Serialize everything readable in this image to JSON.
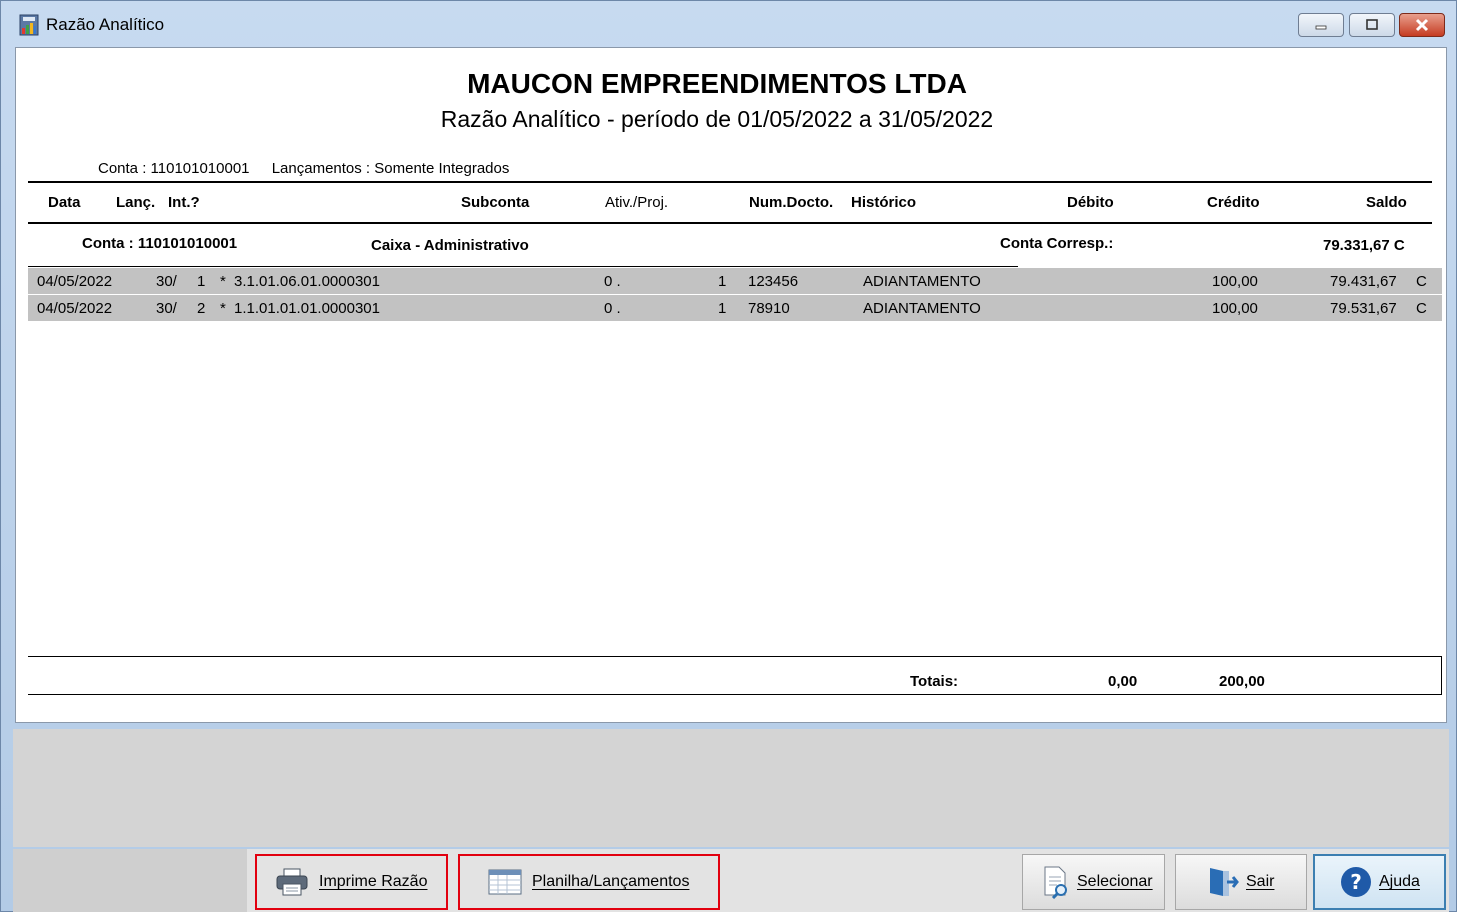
{
  "window": {
    "title": "Razão Analítico",
    "controls": [
      "minimize",
      "maximize",
      "close"
    ]
  },
  "report": {
    "company": "MAUCON EMPREENDIMENTOS LTDA",
    "subtitle": "Razão Analítico - período de 01/05/2022 a 31/05/2022",
    "conta_info": "Conta : 110101010001",
    "lancamentos_info": "Lançamentos : Somente Integrados",
    "headers": {
      "data": "Data",
      "lanc": "Lanç.",
      "int": "Int.?",
      "subconta": "Subconta",
      "ativ": "Ativ./Proj.",
      "numdocto": "Num.Docto.",
      "historico": "Histórico",
      "debito": "Débito",
      "credito": "Crédito",
      "saldo": "Saldo"
    },
    "account": {
      "label": "Conta : 110101010001",
      "name": "Caixa - Administrativo",
      "corresp_label": "Conta Corresp.:",
      "opening_balance": "79.331,67 C"
    },
    "rows": [
      {
        "data": "04/05/2022",
        "lanc": "30/",
        "seq": "1",
        "int": "*",
        "subconta": "3.1.01.06.01.0000301",
        "ativ": "0 .",
        "ativ_n": "1",
        "numdocto": "123456",
        "historico": "ADIANTAMENTO",
        "credito": "100,00",
        "saldo": "79.431,67",
        "dc": "C"
      },
      {
        "data": "04/05/2022",
        "lanc": "30/",
        "seq": "2",
        "int": "*",
        "subconta": "1.1.01.01.01.0000301",
        "ativ": "0 .",
        "ativ_n": "1",
        "numdocto": "78910",
        "historico": "ADIANTAMENTO",
        "credito": "100,00",
        "saldo": "79.531,67",
        "dc": "C"
      }
    ],
    "totals": {
      "label": "Totais:",
      "debito": "0,00",
      "credito": "200,00"
    }
  },
  "toolbar": {
    "imprime": "Imprime Razão",
    "planilha": "Planilha/Lançamentos",
    "selecionar": "Selecionar",
    "sair": "Sair",
    "ajuda": "Ajuda"
  },
  "colors": {
    "highlight_border": "#e2000f",
    "row_bg": "#c2c2c2",
    "close_button": "#c53c22"
  }
}
